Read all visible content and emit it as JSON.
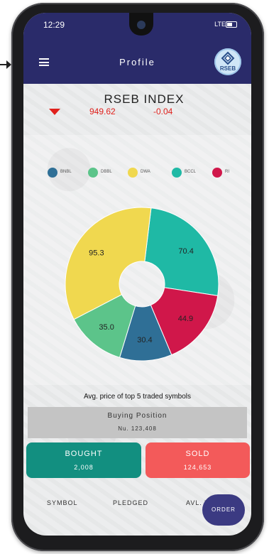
{
  "status_bar": {
    "time": "12:29",
    "network": "LTE"
  },
  "header": {
    "title": "Profile",
    "logo_text": "RSEB"
  },
  "index": {
    "name": "RSEB INDEX",
    "value": "949.62",
    "change": "-0.04",
    "direction": "down"
  },
  "legend": [
    {
      "label": "BNBL",
      "color": "#2f6f96"
    },
    {
      "label": "DBBL",
      "color": "#5cc48a"
    },
    {
      "label": "DWA",
      "color": "#f0d84f"
    },
    {
      "label": "BCCL",
      "color": "#1fb9a5"
    },
    {
      "label": "RI",
      "color": "#d0174a"
    }
  ],
  "chart_data": {
    "type": "pie",
    "donut": true,
    "slices": [
      {
        "label": "",
        "value": 70.4,
        "color": "#1fb9a5"
      },
      {
        "label": "",
        "value": 44.9,
        "color": "#d0174a"
      },
      {
        "label": "",
        "value": 30.4,
        "color": "#2f6f96"
      },
      {
        "label": "",
        "value": 35.0,
        "color": "#5cc48a"
      },
      {
        "label": "",
        "value": 95.3,
        "color": "#f0d84f"
      }
    ],
    "caption": "Avg. price of top 5 traded symbols"
  },
  "buying": {
    "title": "Buying Position",
    "value": "Nu. 123,408"
  },
  "bought": {
    "label": "BOUGHT",
    "value": "2,008"
  },
  "sold": {
    "label": "SOLD",
    "value": "124,653"
  },
  "columns": {
    "symbol": "SYMBOL",
    "pledged": "PLEDGED",
    "avl_vol": "AVL. VOL"
  },
  "order_button": "ORDER"
}
